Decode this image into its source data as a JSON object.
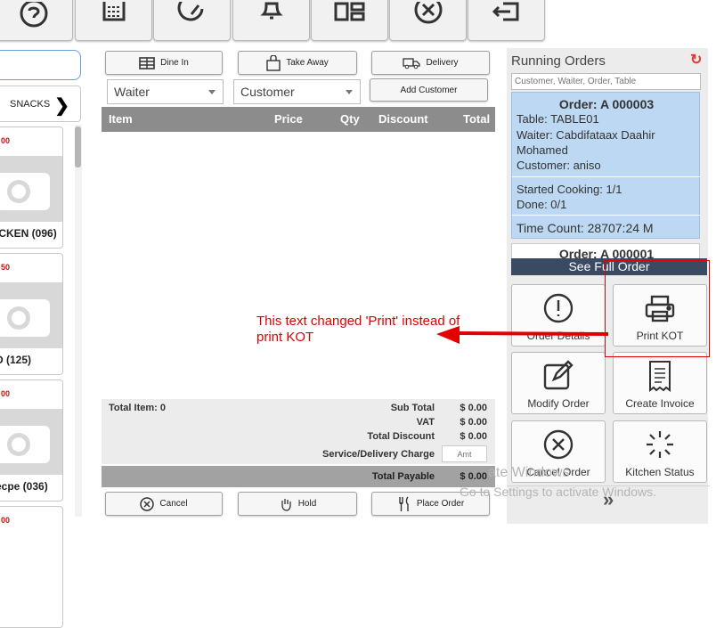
{
  "toolbar": {
    "icons": [
      "help-icon",
      "calculator-icon",
      "refresh-icon",
      "bell-icon",
      "layout-icon",
      "close-circle-icon",
      "logout-icon"
    ]
  },
  "left": {
    "category_label": "SNACKS",
    "items": [
      {
        "price": "00",
        "name": "ICKEN (096)"
      },
      {
        "price": "50",
        "name": "D (125)"
      },
      {
        "price": "00",
        "name": "ecpe (036)"
      },
      {
        "price": "00",
        "name": ""
      }
    ]
  },
  "order_type": {
    "dine_in": "Dine In",
    "take_away": "Take Away",
    "delivery": "Delivery",
    "add_customer": "Add Customer"
  },
  "selects": {
    "waiter": "Waiter",
    "customer": "Customer"
  },
  "table": {
    "headers": {
      "item": "Item",
      "price": "Price",
      "qty": "Qty",
      "discount": "Discount",
      "total": "Total"
    }
  },
  "summary": {
    "total_item": "Total Item: 0",
    "sub_total_label": "Sub Total",
    "sub_total": "$ 0.00",
    "vat_label": "VAT",
    "vat": "$ 0.00",
    "discount_label": "Total Discount",
    "discount": "$ 0.00",
    "service_label": "Service/Delivery Charge",
    "amt_placeholder": "Amt",
    "payable_label": "Total Payable",
    "payable": "$ 0.00"
  },
  "bottom_buttons": {
    "cancel": "Cancel",
    "hold": "Hold",
    "place_order": "Place Order"
  },
  "running_orders": {
    "title": "Running Orders",
    "search_placeholder": "Customer, Waiter, Order, Table",
    "order": {
      "title": "Order: A 000003",
      "table": "Table: TABLE01",
      "waiter": "Waiter: Cabdifataax Daahir",
      "waiter_cont": "Mohamed",
      "customer": "Customer: aniso",
      "started": "Started Cooking: 1/1",
      "done": "Done: 0/1",
      "time": "Time Count: 28707:24 M"
    },
    "next_order_partial": "Order: A 000001",
    "see_full_order": "See Full Order",
    "actions": {
      "order_details": "Order Details",
      "print_kot": "Print KOT",
      "modify_order": "Modify Order",
      "create_invoice": "Create Invoice",
      "cancel_order": "Cancel Order",
      "kitchen_status": "Kitchen Status"
    }
  },
  "annotation": {
    "line1": "This text changed 'Print' instead of",
    "line2": "print KOT"
  },
  "watermark": {
    "line1": "ate Windows",
    "line2": "Go to Settings to activate Windows."
  },
  "colors": {
    "accent_blue": "#6aa0d8",
    "order_card": "#bcd8f2",
    "see_full_bar": "#3a4a63",
    "annotation_red": "#e00000",
    "price_red": "#d01010"
  }
}
